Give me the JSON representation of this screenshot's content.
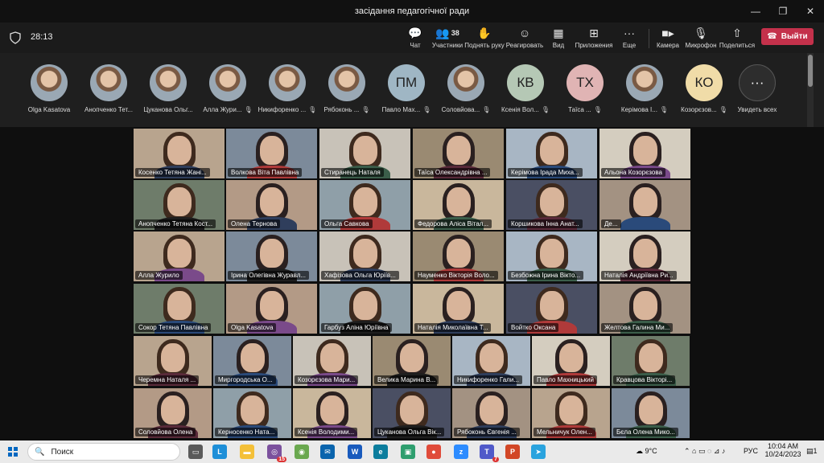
{
  "window": {
    "title": "засідання педагогічної ради"
  },
  "toolbar": {
    "timer": "28:13",
    "chat": "Чат",
    "participants": "Участники",
    "participants_count": "38",
    "raise_hand": "Поднять руку",
    "react": "Реагировать",
    "view": "Вид",
    "apps": "Приложения",
    "more": "Еще",
    "camera": "Камера",
    "mic": "Микрофон",
    "share": "Поделиться",
    "leave": "Выйти"
  },
  "strip": [
    {
      "name": "Olga Kasatova",
      "initials": "",
      "color": "#9aa8b4"
    },
    {
      "name": "Анопченко Тет...",
      "initials": "",
      "color": "#9aa8b4"
    },
    {
      "name": "Цуканова Ольг...",
      "initials": "",
      "color": "#9aa8b4"
    },
    {
      "name": "Алла Жури...",
      "initials": "",
      "color": "#9aa8b4"
    },
    {
      "name": "Никифоренко ...",
      "initials": "",
      "color": "#9aa8b4"
    },
    {
      "name": "Рябоконь ...",
      "initials": "",
      "color": "#9aa8b4"
    },
    {
      "name": "Павло Мах...",
      "initials": "ПМ",
      "color": "#9fb6c4"
    },
    {
      "name": "Соловйова...",
      "initials": "",
      "color": "#9aa8b4"
    },
    {
      "name": "Ксенія Вол...",
      "initials": "КВ",
      "color": "#b5c8b5"
    },
    {
      "name": "Таїса ...",
      "initials": "ТХ",
      "color": "#e0b4b4"
    },
    {
      "name": "Керімова І...",
      "initials": "",
      "color": "#9aa8b4"
    },
    {
      "name": "Козорєзов...",
      "initials": "КО",
      "color": "#f0dca8"
    },
    {
      "name": "Увидеть всех",
      "initials": "···",
      "color": "#2d2d2d"
    }
  ],
  "gallery": {
    "row1": [
      "Косенко Тетяна Жані...",
      "Волкова Віта Павлівна",
      "Стиранець Наталя",
      "Таїса Олександрівна ...",
      "Керімова Ірада Миха...",
      "Альона Козорєзова"
    ],
    "row2": [
      "Анопченко Тетяна Кост...",
      "Олена Тернова",
      "Ольга Савкова",
      "Федорова Аліса Вітал...",
      "Коршикова Інна Анат...",
      "Де..."
    ],
    "row3": [
      "Алла Журило",
      "Ірина Олегівна Журавл...",
      "Хафізова Ольга Юріїв...",
      "Науменко Вікторія Воло...",
      "Безбожна Ірина Вікто...",
      "Наталія Андріївна Ри..."
    ],
    "row4": [
      "Сокор Тетяна Павлівна",
      "Olga Kasatova",
      "Гарбуз Аліна Юріївна",
      "Наталія Миколаївна Т...",
      "Войтко Оксана",
      "Желтова Галина Ми..."
    ],
    "row5": [
      "Черемна Наталя ...",
      "Миргородська О...",
      "Козорєзова Мари...",
      "Велика Марина В...",
      "Никифоренко Гали...",
      "Павло Махницький",
      "Кравцова Вікторі..."
    ],
    "row6": [
      "Соловйова Олена",
      "Керносенко Ната...",
      "Ксенія Володими...",
      "Цуканова Ольга Вік...",
      "Рябоконь Євгенія ...",
      "Мельничук Олен...",
      "Бєла Олена Мико..."
    ]
  },
  "taskbar": {
    "search": "Поиск",
    "weather": "9°C",
    "lang": "РУС",
    "time": "10:04 AM",
    "date": "10/24/2023",
    "badge_viber": "15",
    "badge_teams": "7",
    "notif": "1"
  }
}
